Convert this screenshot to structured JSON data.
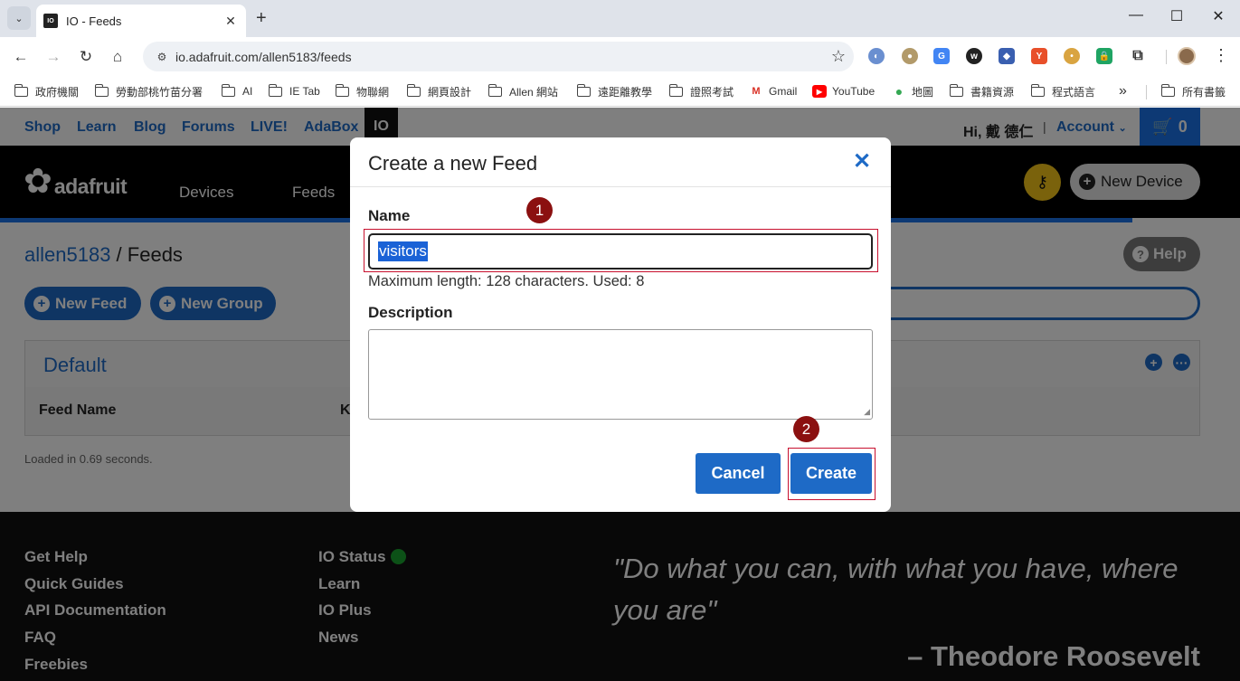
{
  "browser": {
    "tab_title": "IO - Feeds",
    "url": "io.adafruit.com/allen5183/feeds",
    "bookmarks": [
      "政府機關",
      "勞動部桃竹苗分署",
      "AI",
      "IE Tab",
      "物聯網",
      "網頁設計",
      "Allen 網站",
      "遠距離教學",
      "證照考試",
      "Gmail",
      "YouTube",
      "地圖",
      "書籍資源",
      "程式語言",
      "所有書籤"
    ]
  },
  "topnav": {
    "links": [
      "Shop",
      "Learn",
      "Blog",
      "Forums",
      "LIVE!",
      "AdaBox",
      "IO"
    ],
    "greeting": "Hi, 戴 德仁",
    "separator": "|",
    "account": "Account",
    "cart_count": "0"
  },
  "mainnav": {
    "logo_text": "adafruit",
    "links": [
      "Devices",
      "Feeds"
    ],
    "new_device": "New Device"
  },
  "page": {
    "breadcrumb_user": "allen5183",
    "breadcrumb_sep": " / ",
    "breadcrumb_page": "Feeds",
    "help": "Help",
    "new_feed": "New Feed",
    "new_group": "New Group",
    "group_title": "Default",
    "col_feed_name": "Feed Name",
    "col_key": "K",
    "loaded": "Loaded in 0.69 seconds."
  },
  "footer": {
    "col1": [
      "Get Help",
      "Quick Guides",
      "API Documentation",
      "FAQ",
      "Freebies"
    ],
    "col2": [
      "IO Status",
      "Learn",
      "IO Plus",
      "News"
    ],
    "quote": "\"Do what you can, with what you have, where you are\"",
    "author": "– Theodore Roosevelt"
  },
  "modal": {
    "title": "Create a new Feed",
    "name_label": "Name",
    "name_value": "visitors",
    "hint": "Maximum length: 128 characters. Used: 8",
    "description_label": "Description",
    "description_value": "",
    "cancel": "Cancel",
    "create": "Create"
  },
  "annotations": [
    "1",
    "2"
  ],
  "colors": {
    "accent_blue": "#1e6ac6",
    "annotation_red": "#c8102e",
    "annotation_badge": "#8b1010",
    "status_green": "#19a32e",
    "key_yellow": "#f5c518"
  }
}
